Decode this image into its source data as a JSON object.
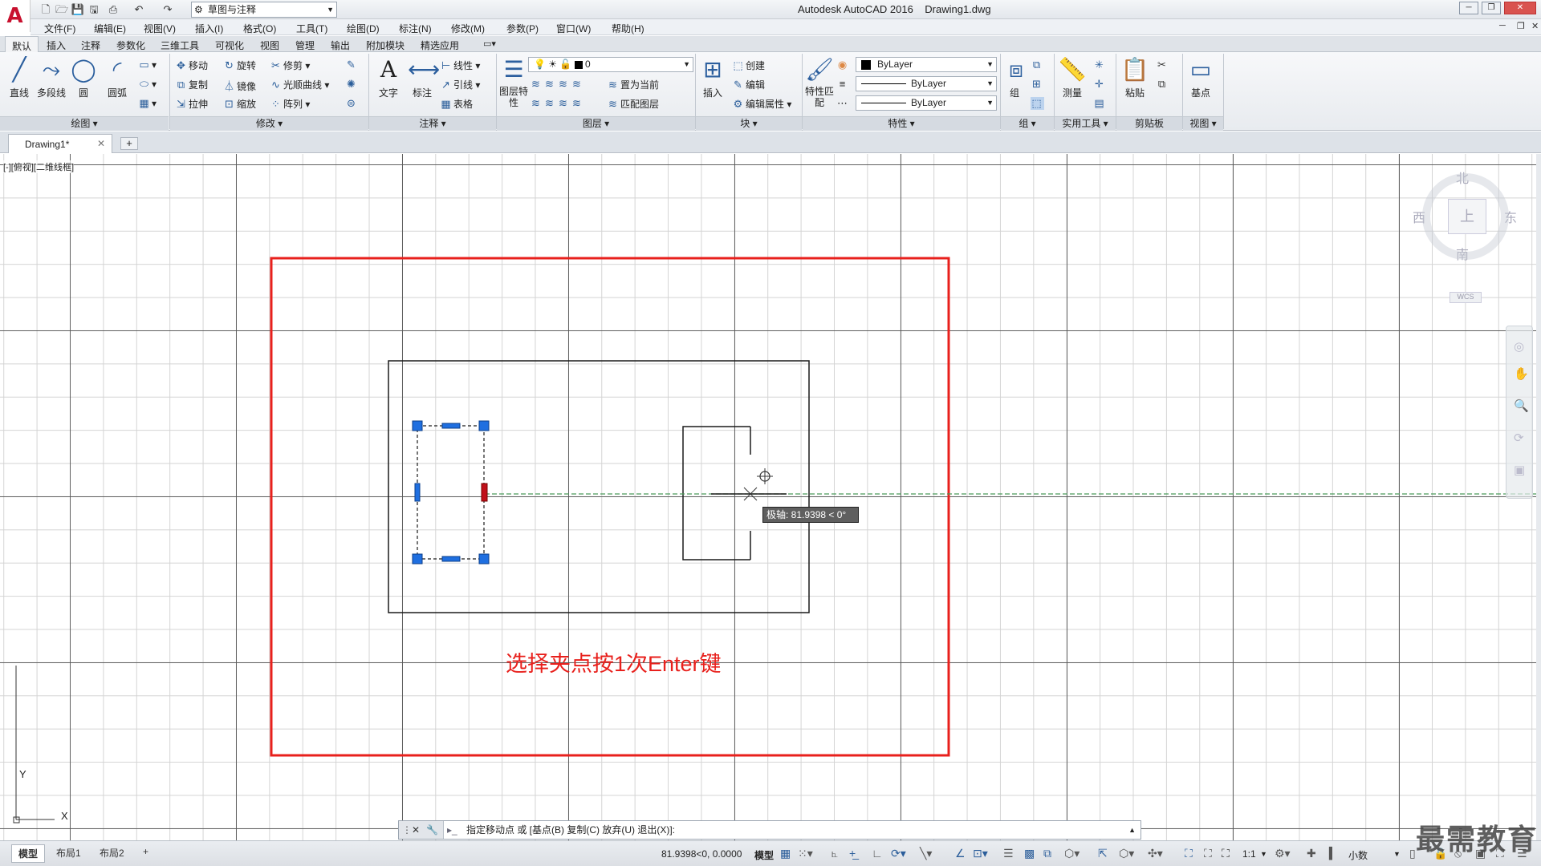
{
  "window": {
    "title": "Autodesk AutoCAD 2016    Drawing1.dwg",
    "workspace": "草图与注释",
    "controls": [
      "─",
      "❐",
      "✕"
    ]
  },
  "menu": [
    "文件(F)",
    "编辑(E)",
    "视图(V)",
    "插入(I)",
    "格式(O)",
    "工具(T)",
    "绘图(D)",
    "标注(N)",
    "修改(M)",
    "参数(P)",
    "窗口(W)",
    "帮助(H)"
  ],
  "ribbon_tabs": [
    "默认",
    "插入",
    "注释",
    "参数化",
    "三维工具",
    "可视化",
    "视图",
    "管理",
    "输出",
    "附加模块",
    "精选应用"
  ],
  "ribbon": {
    "draw": {
      "title": "绘图",
      "big": [
        "直线",
        "多段线",
        "圆",
        "圆弧"
      ]
    },
    "modify": {
      "title": "修改",
      "tools": [
        "移动",
        "旋转",
        "修剪",
        "复制",
        "镜像",
        "光顺曲线",
        "拉伸",
        "缩放",
        "阵列"
      ]
    },
    "annotation": {
      "title": "注释",
      "big": [
        "文字",
        "标注"
      ],
      "tools": [
        "线性",
        "引线",
        "表格"
      ]
    },
    "layers": {
      "title": "图层",
      "big": "图层特性",
      "current_layer": "0",
      "tools": [
        "置为当前",
        "匹配图层"
      ]
    },
    "block": {
      "title": "块",
      "big": "插入",
      "tools": [
        "创建",
        "编辑",
        "编辑属性"
      ]
    },
    "properties": {
      "title": "特性",
      "big": "特性匹配",
      "color": "ByLayer",
      "linetype": "ByLayer",
      "lineweight": "ByLayer"
    },
    "group": {
      "title": "组",
      "big": "组"
    },
    "utilities": {
      "title": "实用工具",
      "big": "测量"
    },
    "clipboard": {
      "title": "剪贴板",
      "big": "粘贴"
    },
    "view": {
      "title": "视图",
      "big": "基点"
    }
  },
  "file_tab": "Drawing1*",
  "viewport_label": "[-][俯视][二维线框]",
  "viewcube": {
    "north": "北",
    "south": "南",
    "east": "东",
    "west": "西",
    "face": "上",
    "wcs": "WCS"
  },
  "tooltip": "极轴: 81.9398 < 0°",
  "annotation_text": "选择夹点按1次Enter键",
  "ucs": {
    "x": "X",
    "y": "Y"
  },
  "command_line": "指定移动点 或 [基点(B) 复制(C) 放弃(U) 退出(X)]:",
  "status": {
    "layouts": [
      "模型",
      "布局1",
      "布局2"
    ],
    "coords": "81.9398<0, 0.0000",
    "model": "模型",
    "scale": "1:1",
    "units": "小数"
  },
  "watermark": "最需教育",
  "colors": {
    "highlight_box": "#e8201c",
    "grip": "#1f6fe0",
    "grip_hot": "#c0101a",
    "tracking_line": "#4a9a5a"
  }
}
